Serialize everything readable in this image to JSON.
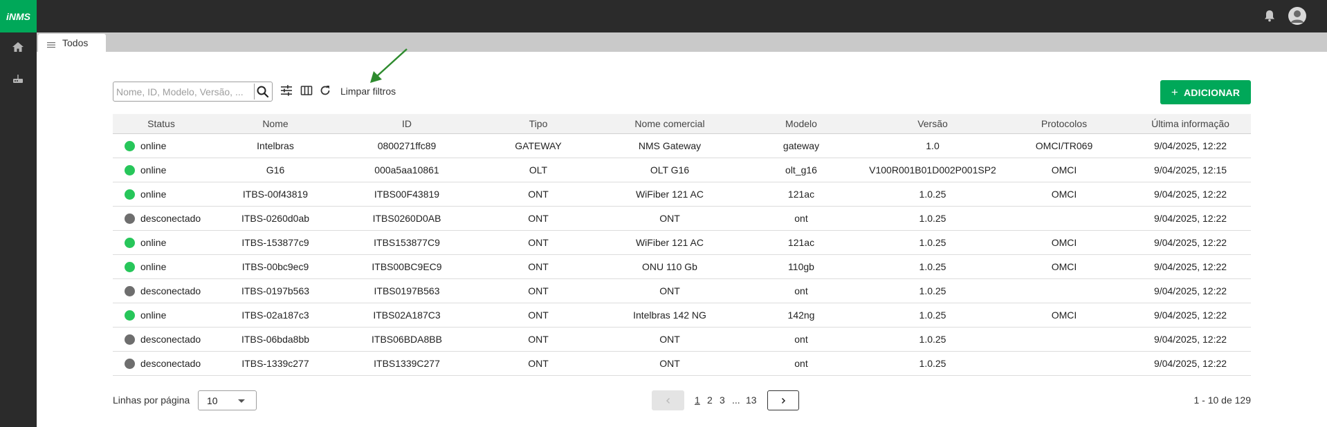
{
  "app": {
    "logo": "iNMS"
  },
  "tab": {
    "label": "Todos"
  },
  "toolbar": {
    "search_placeholder": "Nome, ID, Modelo, Versão, ...",
    "clear_filters": "Limpar filtros",
    "add_label": "ADICIONAR"
  },
  "table": {
    "headers": [
      "Status",
      "Nome",
      "ID",
      "Tipo",
      "Nome comercial",
      "Modelo",
      "Versão",
      "Protocolos",
      "Última informação"
    ],
    "rows": [
      {
        "status": "online",
        "nome": "Intelbras",
        "id": "0800271ffc89",
        "tipo": "GATEWAY",
        "comercial": "NMS Gateway",
        "modelo": "gateway",
        "versao": "1.0",
        "protocolos": "OMCI/TR069",
        "ultima": "9/04/2025, 12:22"
      },
      {
        "status": "online",
        "nome": "G16",
        "id": "000a5aa10861",
        "tipo": "OLT",
        "comercial": "OLT G16",
        "modelo": "olt_g16",
        "versao": "V100R001B01D002P001SP2",
        "protocolos": "OMCI",
        "ultima": "9/04/2025, 12:15"
      },
      {
        "status": "online",
        "nome": "ITBS-00f43819",
        "id": "ITBS00F43819",
        "tipo": "ONT",
        "comercial": "WiFiber 121 AC",
        "modelo": "121ac",
        "versao": "1.0.25",
        "protocolos": "OMCI",
        "ultima": "9/04/2025, 12:22"
      },
      {
        "status": "desconectado",
        "nome": "ITBS-0260d0ab",
        "id": "ITBS0260D0AB",
        "tipo": "ONT",
        "comercial": "ONT",
        "modelo": "ont",
        "versao": "1.0.25",
        "protocolos": "",
        "ultima": "9/04/2025, 12:22"
      },
      {
        "status": "online",
        "nome": "ITBS-153877c9",
        "id": "ITBS153877C9",
        "tipo": "ONT",
        "comercial": "WiFiber 121 AC",
        "modelo": "121ac",
        "versao": "1.0.25",
        "protocolos": "OMCI",
        "ultima": "9/04/2025, 12:22"
      },
      {
        "status": "online",
        "nome": "ITBS-00bc9ec9",
        "id": "ITBS00BC9EC9",
        "tipo": "ONT",
        "comercial": "ONU 110 Gb",
        "modelo": "110gb",
        "versao": "1.0.25",
        "protocolos": "OMCI",
        "ultima": "9/04/2025, 12:22"
      },
      {
        "status": "desconectado",
        "nome": "ITBS-0197b563",
        "id": "ITBS0197B563",
        "tipo": "ONT",
        "comercial": "ONT",
        "modelo": "ont",
        "versao": "1.0.25",
        "protocolos": "",
        "ultima": "9/04/2025, 12:22"
      },
      {
        "status": "online",
        "nome": "ITBS-02a187c3",
        "id": "ITBS02A187C3",
        "tipo": "ONT",
        "comercial": "Intelbras 142 NG",
        "modelo": "142ng",
        "versao": "1.0.25",
        "protocolos": "OMCI",
        "ultima": "9/04/2025, 12:22"
      },
      {
        "status": "desconectado",
        "nome": "ITBS-06bda8bb",
        "id": "ITBS06BDA8BB",
        "tipo": "ONT",
        "comercial": "ONT",
        "modelo": "ont",
        "versao": "1.0.25",
        "protocolos": "",
        "ultima": "9/04/2025, 12:22"
      },
      {
        "status": "desconectado",
        "nome": "ITBS-1339c277",
        "id": "ITBS1339C277",
        "tipo": "ONT",
        "comercial": "ONT",
        "modelo": "ont",
        "versao": "1.0.25",
        "protocolos": "",
        "ultima": "9/04/2025, 12:22"
      }
    ]
  },
  "footer": {
    "rows_label": "Linhas por página",
    "rows_value": "10",
    "pages": [
      "1",
      "2",
      "3",
      "...",
      "13"
    ],
    "range": "1 - 10 de 129"
  },
  "colors": {
    "accent": "#00a859",
    "online": "#27c65a",
    "offline": "#6e6e6e",
    "sidebar": "#2b2b2b"
  },
  "icons": [
    "home-icon",
    "router-icon",
    "bell-icon",
    "user-avatar-icon",
    "menu-icon",
    "search-icon",
    "filter-icon",
    "columns-icon",
    "refresh-icon",
    "arrow-annotation",
    "chevron-left-icon",
    "chevron-right-icon"
  ]
}
